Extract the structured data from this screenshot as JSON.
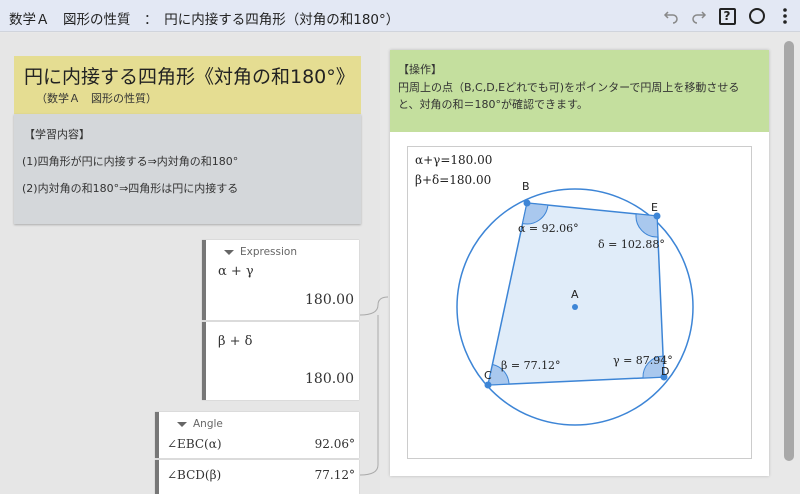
{
  "toolbar": {
    "title": "数学Ａ　図形の性質　：　円に内接する四角形（対角の和180°）",
    "undo_icon": "undo-icon",
    "redo_icon": "redo-icon",
    "help_icon": "help-icon",
    "help_label": "?",
    "circle_icon": "circle-icon",
    "menu_icon": "more-vertical-icon"
  },
  "lesson": {
    "title": "円に内接する四角形《対角の和180°》",
    "subtitle": "（数学Ａ　図形の性質）",
    "content_heading": "【学習内容】",
    "items": [
      "(1)四角形が円に内接する⇒内対角の和180°",
      "(2)内対角の和180°⇒四角形は円に内接する"
    ]
  },
  "expression_panel": {
    "header": "Expression",
    "rows": [
      {
        "label": "α + γ",
        "value": "180.00"
      },
      {
        "label": "β + δ",
        "value": "180.00"
      }
    ]
  },
  "angle_panel": {
    "header": "Angle",
    "rows": [
      {
        "label": "∠EBC(α)",
        "value": "92.06°"
      },
      {
        "label": "∠BCD(β)",
        "value": "77.12°"
      }
    ]
  },
  "operation": {
    "heading": "【操作】",
    "line1": "円周上の点（B,C,D,Eどれでも可)をポインターで円周上を移動させる",
    "line2": "と、対角の和＝180°が確認できます。"
  },
  "diagram": {
    "sum1": "α+γ=180.00",
    "sum2": "β+δ=180.00",
    "center_label": "A",
    "points": {
      "B": "B",
      "C": "C",
      "D": "D",
      "E": "E"
    },
    "angles": {
      "alpha": "α = 92.06°",
      "beta": "β = 77.12°",
      "gamma": "γ = 87.94°",
      "delta": "δ = 102.88°"
    },
    "colors": {
      "circle": "#3d85d6",
      "fill": "#ddeaf8",
      "sector": "#a9c8ee",
      "point": "#3d85d6"
    }
  }
}
